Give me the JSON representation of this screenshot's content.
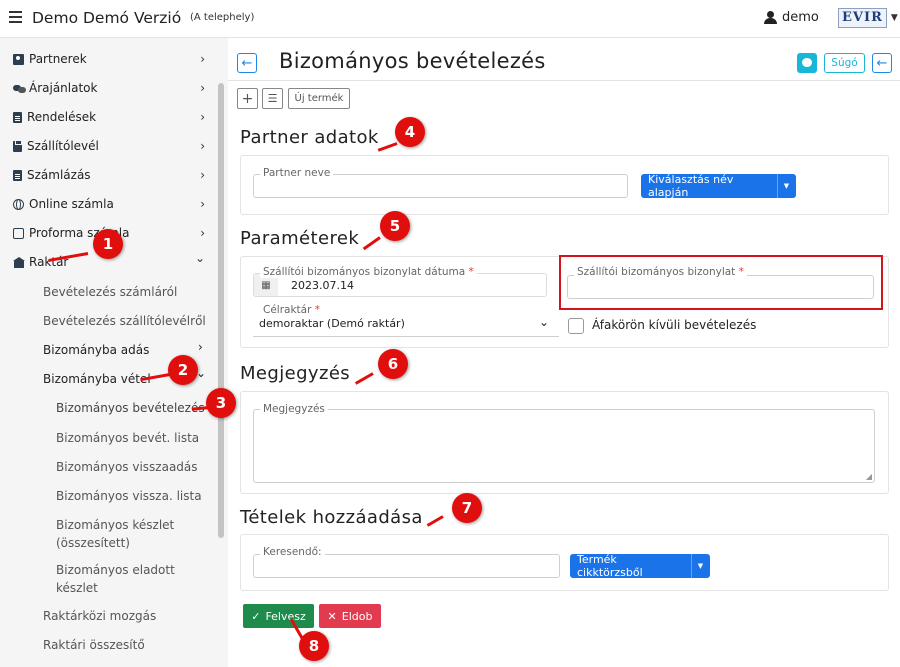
{
  "header": {
    "app_title": "Demo Demó Verzió",
    "app_subtitle": "(A telephely)",
    "user_name": "demo",
    "logo_text": "EVIR"
  },
  "sidebar": {
    "items": [
      {
        "label": "Partnerek",
        "icon": "address-card-icon",
        "chevron": "›"
      },
      {
        "label": "Árajánlatok",
        "icon": "comments-icon",
        "chevron": "›"
      },
      {
        "label": "Rendelések",
        "icon": "file-icon",
        "chevron": "›"
      },
      {
        "label": "Szállítólevél",
        "icon": "clipboard-icon",
        "chevron": "›"
      },
      {
        "label": "Számlázás",
        "icon": "invoice-icon",
        "chevron": "›"
      },
      {
        "label": "Online számla",
        "icon": "globe-icon",
        "chevron": "›"
      },
      {
        "label": "Proforma számla",
        "icon": "proforma-icon",
        "chevron": "›"
      },
      {
        "label": "Raktár",
        "icon": "warehouse-icon",
        "chevron": "⌄"
      }
    ],
    "raktar_sub": [
      "Bevételezés számláról",
      "Bevételezés szállítólevélről",
      "Bizományba adás",
      "Bizományba vétel"
    ],
    "bizomany_sub": [
      "Bizományos bevételezés",
      "Bizományos bevét. lista",
      "Bizományos visszaadás",
      "Bizományos vissza. lista",
      "Bizományos készlet (összesített)",
      "Bizományos eladott készlet"
    ],
    "raktar_tail": [
      "Raktárközi mozgás",
      "Raktári összesítő"
    ]
  },
  "page": {
    "title": "Bizományos bevételezés",
    "help_label": "Súgó",
    "new_product_label": "Új termék"
  },
  "partner": {
    "section_title": "Partner adatok",
    "name_label": "Partner neve",
    "name_value": "",
    "select_button": "Kiválasztás név alapján"
  },
  "params": {
    "section_title": "Paraméterek",
    "date_label": "Szállítói bizományos bizonylat dátuma",
    "date_value": "2023.07.14",
    "doc_label": "Szállítói bizományos bizonylat",
    "doc_value": "",
    "warehouse_label": "Célraktár",
    "warehouse_value": "demoraktar (Demó raktár)",
    "vat_checkbox_label": "Áfakörön kívüli bevételezés",
    "vat_checked": false
  },
  "note": {
    "section_title": "Megjegyzés",
    "field_label": "Megjegyzés",
    "value": ""
  },
  "items": {
    "section_title": "Tételek hozzáadása",
    "search_label": "Keresendő:",
    "search_value": "",
    "catalog_button": "Termék cikktörzsből"
  },
  "actions": {
    "save_label": "Felvesz",
    "drop_label": "Eldob"
  },
  "annotations": [
    "1",
    "2",
    "3",
    "4",
    "5",
    "6",
    "7",
    "8"
  ],
  "colors": {
    "primary": "#1a73e8",
    "success": "#1e8a4c",
    "danger": "#e23a4e",
    "info": "#18b7d7",
    "marker": "#e10e0e"
  }
}
